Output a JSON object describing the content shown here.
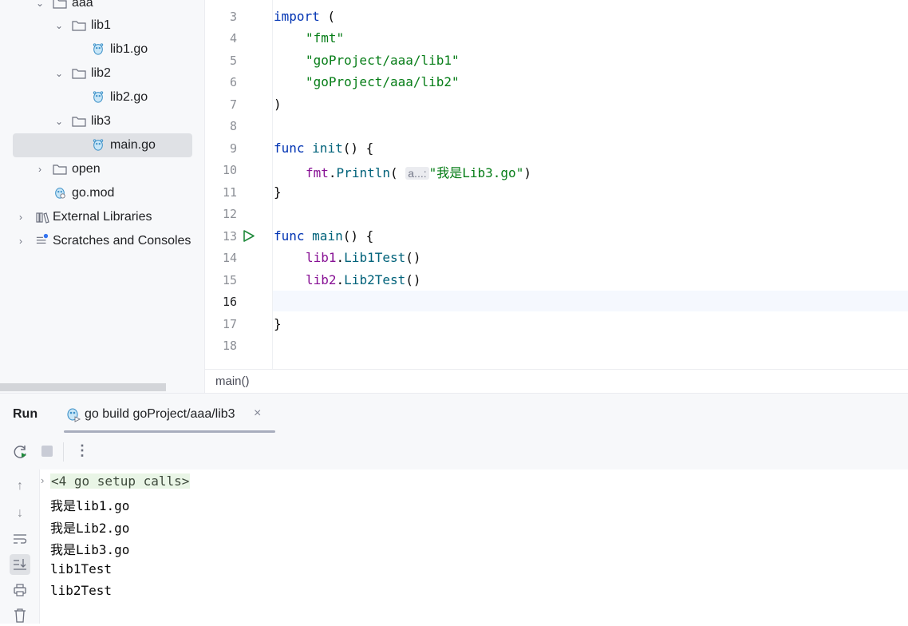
{
  "project_tree": {
    "items": [
      {
        "label": "aaa",
        "type": "folder",
        "expanded": true
      },
      {
        "label": "lib1",
        "type": "folder",
        "expanded": true
      },
      {
        "label": "lib1.go",
        "type": "go-file"
      },
      {
        "label": "lib2",
        "type": "folder",
        "expanded": true
      },
      {
        "label": "lib2.go",
        "type": "go-file"
      },
      {
        "label": "lib3",
        "type": "folder",
        "expanded": true
      },
      {
        "label": "main.go",
        "type": "go-file",
        "selected": true
      },
      {
        "label": "open",
        "type": "folder",
        "expanded": false
      },
      {
        "label": "go.mod",
        "type": "go-mod-file"
      },
      {
        "label": "External Libraries",
        "type": "libraries",
        "expanded": false
      },
      {
        "label": "Scratches and Consoles",
        "type": "scratches",
        "expanded": false
      }
    ]
  },
  "editor": {
    "lines": [
      {
        "num": "3",
        "text": "import ("
      },
      {
        "num": "4",
        "text": "\"fmt\""
      },
      {
        "num": "5",
        "text": "\"goProject/aaa/lib1\""
      },
      {
        "num": "6",
        "text": "\"goProject/aaa/lib2\""
      },
      {
        "num": "7",
        "text": ")"
      },
      {
        "num": "8",
        "text": ""
      },
      {
        "num": "9",
        "text": "func init() {"
      },
      {
        "num": "10",
        "text": "fmt.Println( a...: \"我是Lib3.go\")"
      },
      {
        "num": "11",
        "text": "}"
      },
      {
        "num": "12",
        "text": ""
      },
      {
        "num": "13",
        "text": "func main() {"
      },
      {
        "num": "14",
        "text": "lib1.Lib1Test()"
      },
      {
        "num": "15",
        "text": "lib2.Lib2Test()"
      },
      {
        "num": "16",
        "text": ""
      },
      {
        "num": "17",
        "text": "}"
      },
      {
        "num": "18",
        "text": ""
      }
    ],
    "tokens": {
      "import": "import",
      "open_paren": " (",
      "fmt_str": "\"fmt\"",
      "lib1_str": "\"goProject/aaa/lib1\"",
      "lib2_str": "\"goProject/aaa/lib2\"",
      "close_paren": ")",
      "func": "func",
      "init": "init",
      "init_rest": "() {",
      "fmt": "fmt",
      "dot": ".",
      "println": "Println",
      "paren_open": "(",
      "hint": "a...:",
      "lib3_str": "\"我是Lib3.go\"",
      "paren_close": ")",
      "brace_close": "}",
      "main": "main",
      "main_rest": "() {",
      "lib1": "lib1",
      "lib1test": "Lib1Test",
      "lib2": "lib2",
      "lib2test": "Lib2Test",
      "call": "()"
    },
    "breadcrumb": "main()"
  },
  "run_panel": {
    "title": "Run",
    "tab_label": "go build goProject/aaa/lib3",
    "console_lines": [
      "<4 go setup calls>",
      "我是lib1.go",
      "我是Lib2.go",
      "我是Lib3.go",
      "lib1Test",
      "lib2Test"
    ]
  },
  "colors": {
    "keyword": "#0033b3",
    "string": "#067d17",
    "function": "#00627a",
    "package": "#871094",
    "accent": "#3574f0"
  },
  "icons": {
    "folder": "folder-icon",
    "go_file": "gopher-icon",
    "run": "run-gutter-icon",
    "rerun": "rerun-icon",
    "stop": "stop-icon",
    "more": "more-vertical-icon"
  }
}
